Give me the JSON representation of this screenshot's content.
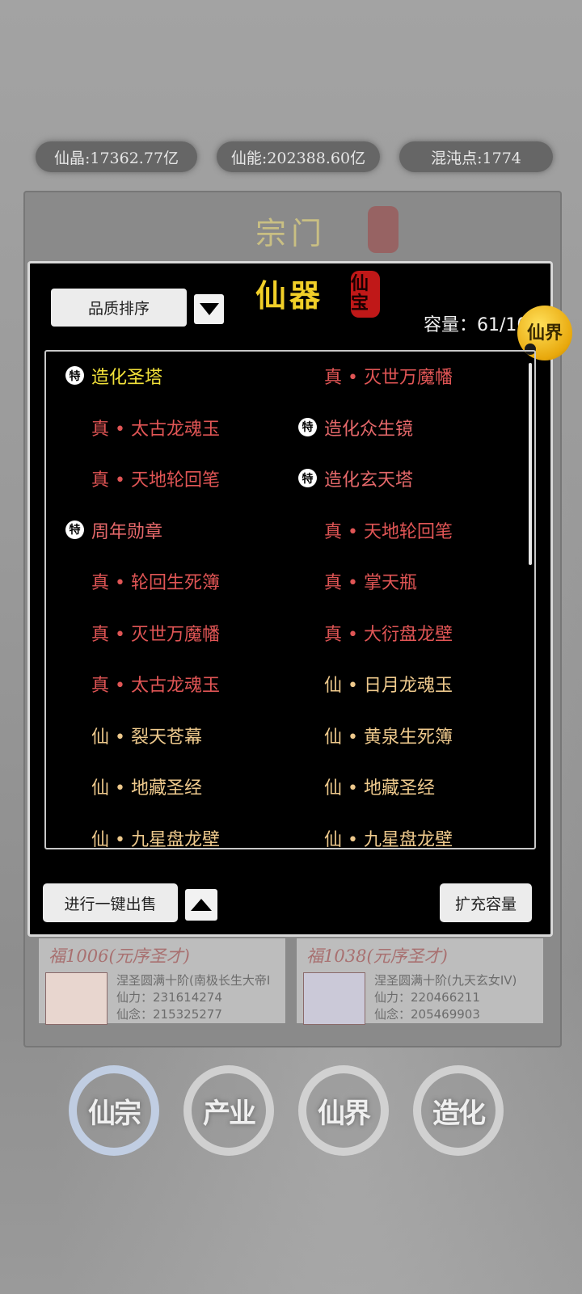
{
  "resources": {
    "xianjing": "仙晶:17362.77亿",
    "xianneng": "仙能:202388.60亿",
    "hundundian": "混沌点:1774"
  },
  "sect": {
    "title": "宗门",
    "members": [
      {
        "name": "福1006(元序圣才)",
        "realm": "涅圣圆满十阶(南极长生大帝I",
        "power": "仙力：231614274",
        "mind": "仙念：215325277"
      },
      {
        "name": "福1038(元序圣才)",
        "realm": "涅圣圆满十阶(九天玄女IV)",
        "power": "仙力：220466211",
        "mind": "仙念：205469903"
      }
    ]
  },
  "artifacts_panel": {
    "title": "仙器",
    "seal_text": "仙宝",
    "sort_label": "品质排序",
    "capacity": "容量：61/10",
    "corner_badge": "仙界",
    "badge_special": "特",
    "items_col1": [
      {
        "name": "造化圣塔",
        "quality": "special",
        "tag": "特"
      },
      {
        "name": "真 • 太古龙魂玉",
        "quality": "zhen"
      },
      {
        "name": "真 • 天地轮回笔",
        "quality": "zhen"
      },
      {
        "name": "周年勋章",
        "quality": "special2",
        "tag": "特"
      },
      {
        "name": "真 • 轮回生死簿",
        "quality": "zhen"
      },
      {
        "name": "真 • 灭世万魔幡",
        "quality": "zhen"
      },
      {
        "name": "真 • 太古龙魂玉",
        "quality": "zhen"
      },
      {
        "name": "仙 • 裂天苍幕",
        "quality": "xian"
      },
      {
        "name": "仙 • 地藏圣经",
        "quality": "xian"
      },
      {
        "name": "仙 • 九星盘龙壁",
        "quality": "xian"
      }
    ],
    "items_col2": [
      {
        "name": "真 • 灭世万魔幡",
        "quality": "zhen"
      },
      {
        "name": "造化众生镜",
        "quality": "special2",
        "tag": "特"
      },
      {
        "name": "造化玄天塔",
        "quality": "special2",
        "tag": "特"
      },
      {
        "name": "真 • 天地轮回笔",
        "quality": "zhen"
      },
      {
        "name": "真 • 掌天瓶",
        "quality": "zhen"
      },
      {
        "name": "真 • 大衍盘龙壁",
        "quality": "zhen"
      },
      {
        "name": "仙 • 日月龙魂玉",
        "quality": "xian"
      },
      {
        "name": "仙 • 黄泉生死簿",
        "quality": "xian"
      },
      {
        "name": "仙 • 地藏圣经",
        "quality": "xian"
      },
      {
        "name": "仙 • 九星盘龙壁",
        "quality": "xian"
      }
    ],
    "sell_label": "进行一键出售",
    "expand_label": "扩充容量"
  },
  "nav": [
    {
      "label": "仙宗",
      "active": true
    },
    {
      "label": "产业"
    },
    {
      "label": "仙界"
    },
    {
      "label": "造化"
    }
  ]
}
